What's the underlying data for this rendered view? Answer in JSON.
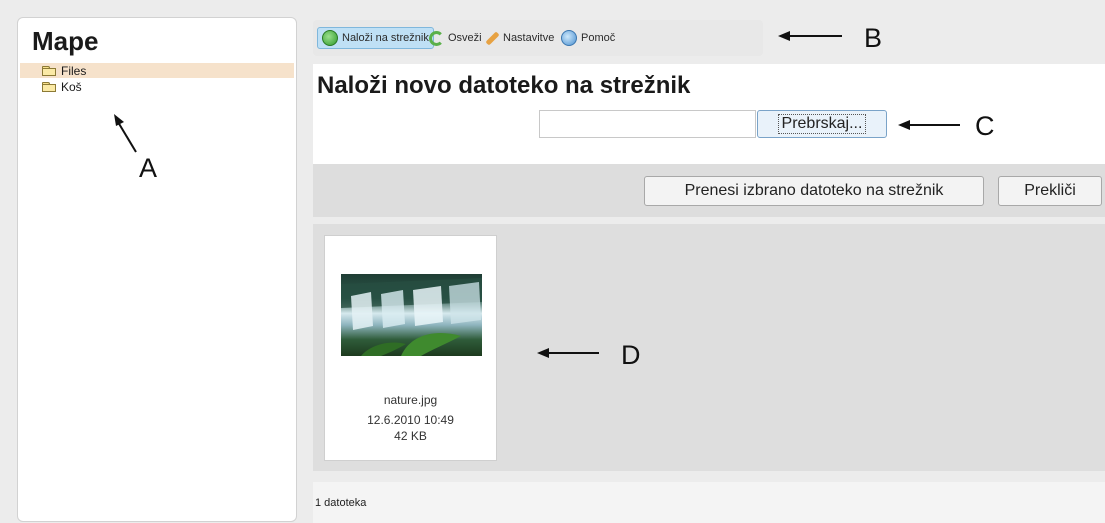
{
  "sidebar": {
    "title": "Mape",
    "folders": [
      {
        "label": "Files",
        "selected": true
      },
      {
        "label": "Koš",
        "selected": false
      }
    ]
  },
  "toolbar": {
    "buttons": [
      {
        "label": "Naloži na strežnik",
        "icon": "upload-icon",
        "active": true
      },
      {
        "label": "Osveži",
        "icon": "refresh-icon",
        "active": false
      },
      {
        "label": "Nastavitve",
        "icon": "wrench-icon",
        "active": false
      },
      {
        "label": "Pomoč",
        "icon": "help-icon",
        "active": false
      }
    ]
  },
  "upload": {
    "title": "Naloži novo datoteko na strežnik",
    "file_value": "",
    "browse_label": "Prebrskaj...",
    "upload_label": "Prenesi izbrano datoteko na strežnik",
    "cancel_label": "Prekliči"
  },
  "files": [
    {
      "name": "nature.jpg",
      "date": "12.6.2010 10:49",
      "size": "42 KB"
    }
  ],
  "status": {
    "text": "1 datoteka"
  },
  "annotations": {
    "a": "A",
    "b": "B",
    "c": "C",
    "d": "D"
  },
  "colors": {
    "selected_row": "#f6e2cb",
    "active_button": "#bfe0f5",
    "panel_gray": "#dddddd"
  }
}
